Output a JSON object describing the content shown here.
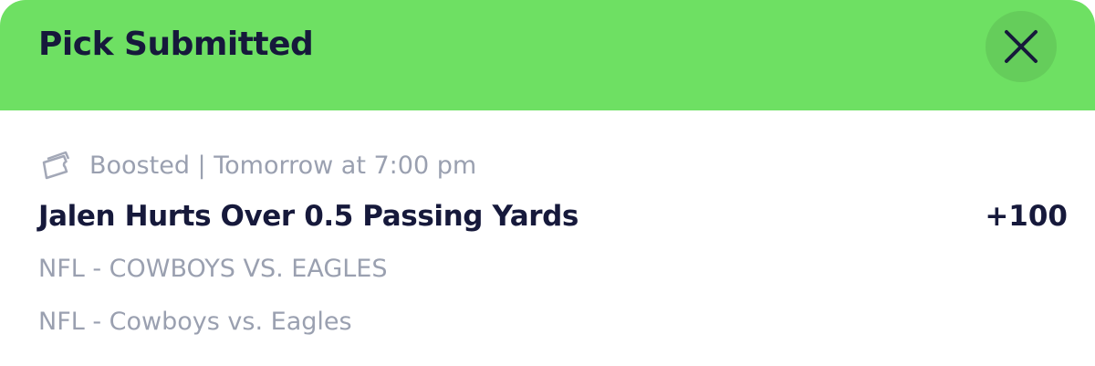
{
  "header": {
    "title": "Pick Submitted",
    "background_color": "#6ee063",
    "close_icon": "close-icon"
  },
  "pick": {
    "meta_icon": "ticket-icon",
    "meta_text": "Boosted | Tomorrow at 7:00 pm",
    "selection": "Jalen Hurts Over 0.5 Passing Yards",
    "odds": "+100",
    "event_upper": "NFL - COWBOYS VS. EAGLES",
    "event": "NFL - Cowboys vs. Eagles"
  },
  "colors": {
    "primary_text": "#16193b",
    "secondary_text": "#9aa0b0",
    "close_button_bg": "#65cd5b"
  }
}
